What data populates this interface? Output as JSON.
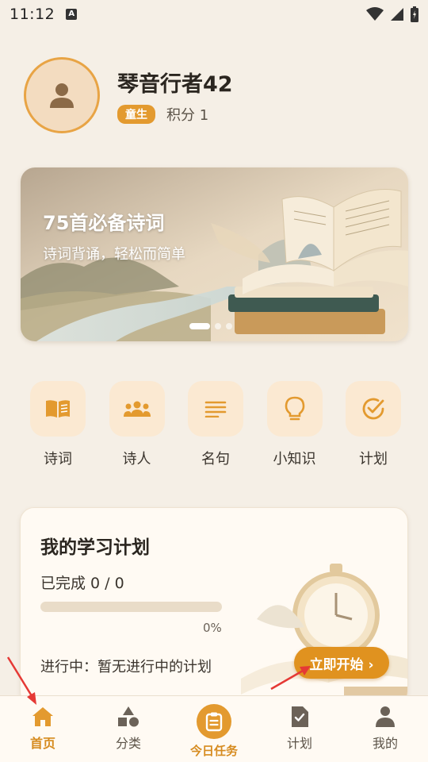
{
  "status_bar": {
    "time": "11:12",
    "notification_glyph": "A"
  },
  "profile": {
    "username": "琴音行者42",
    "level_badge": "童生",
    "points": "积分 1"
  },
  "banner": {
    "title": "75首必备诗词",
    "subtitle": "诗词背诵，轻松而简单",
    "active_slide": 1,
    "slide_count": 3
  },
  "quick_entries": [
    {
      "label": "诗词",
      "icon": "open-book-icon"
    },
    {
      "label": "诗人",
      "icon": "people-icon"
    },
    {
      "label": "名句",
      "icon": "lines-icon"
    },
    {
      "label": "小知识",
      "icon": "lightbulb-icon"
    },
    {
      "label": "计划",
      "icon": "check-circle-icon"
    }
  ],
  "plan": {
    "title": "我的学习计划",
    "progress_text": "已完成 0 / 0",
    "progress_fraction": 0,
    "percent_label": "0%",
    "status_text": "进行中：暂无进行中的计划",
    "start_button": "立即开始 ›"
  },
  "bottom_nav": [
    {
      "label": "首页",
      "icon": "home-icon",
      "active": true
    },
    {
      "label": "分类",
      "icon": "shapes-icon",
      "active": false
    },
    {
      "label": "今日任务",
      "icon": "clipboard-icon",
      "active": false
    },
    {
      "label": "计划",
      "icon": "document-check-icon",
      "active": false
    },
    {
      "label": "我的",
      "icon": "person-icon",
      "active": false
    }
  ],
  "colors": {
    "accent": "#e39a2f",
    "background": "#f5efe6",
    "card": "#fffaf3",
    "icon_tile": "#fbe9d2"
  }
}
